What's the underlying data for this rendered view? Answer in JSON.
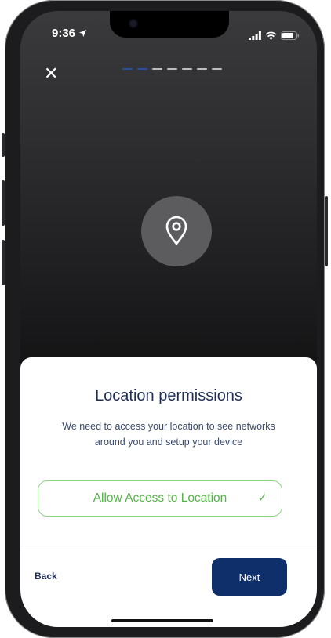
{
  "status_bar": {
    "time": "9:36",
    "icons": [
      "location-arrow-icon",
      "signal-icon",
      "wifi-icon",
      "battery-icon"
    ]
  },
  "top": {
    "close_icon": "close-icon",
    "close_glyph": "✕",
    "progress": {
      "total_steps": 7,
      "current_step": 2
    }
  },
  "hero": {
    "icon": "location-pin-icon"
  },
  "sheet": {
    "title": "Location permissions",
    "description": "We need to access your location to see networks around you and setup your device",
    "allow_button": {
      "label": "Allow Access to Location",
      "check_icon": "check-icon",
      "check_glyph": "✓"
    },
    "back_label": "Back",
    "next_label": "Next"
  },
  "colors": {
    "primary": "#0f2f6a",
    "title": "#1e2f55",
    "success": "#56b24a",
    "progress_active": "#2c4f9c"
  }
}
